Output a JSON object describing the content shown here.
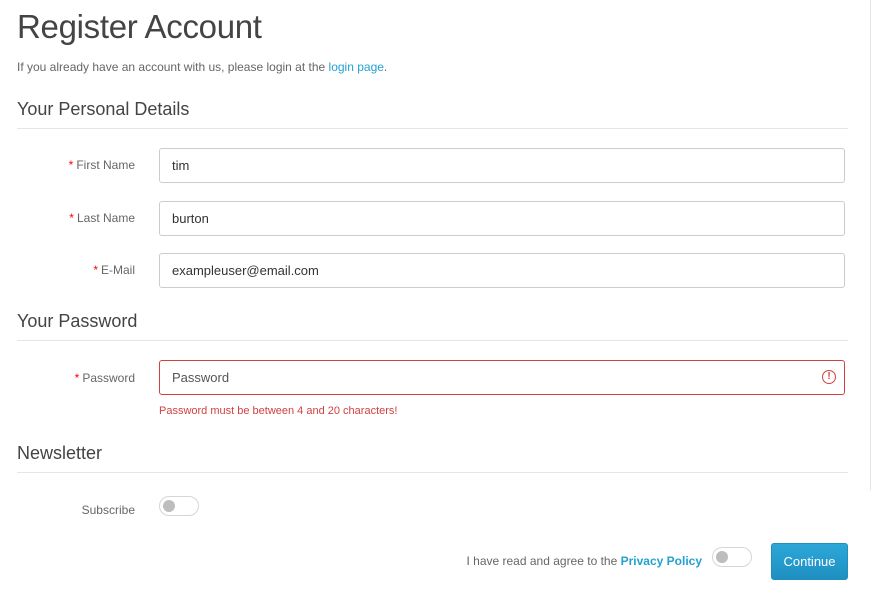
{
  "page": {
    "title": "Register Account",
    "intro_text": "If you already have an account with us, please login at the ",
    "intro_link": "login page",
    "intro_end": "."
  },
  "personal": {
    "legend": "Your Personal Details",
    "firstname": {
      "label": "First Name",
      "value": "tim"
    },
    "lastname": {
      "label": "Last Name",
      "value": "burton"
    },
    "email": {
      "label": "E-Mail",
      "value": "exampleuser@email.com"
    }
  },
  "password": {
    "legend": "Your Password",
    "label": "Password",
    "placeholder": "Password",
    "error": "Password must be between 4 and 20 characters!",
    "error_icon": "exclamation-circle-icon",
    "error_color": "#d14141"
  },
  "newsletter": {
    "legend": "Newsletter",
    "subscribe_label": "Subscribe",
    "subscribe_on": false
  },
  "footer": {
    "agree_text": "I have read and agree to the ",
    "privacy_link": "Privacy Policy",
    "agree_on": false,
    "continue_label": "Continue"
  },
  "required_marker": "*",
  "colors": {
    "link": "#23a1d1",
    "button": "#229ac8",
    "required": "#ff0000"
  }
}
